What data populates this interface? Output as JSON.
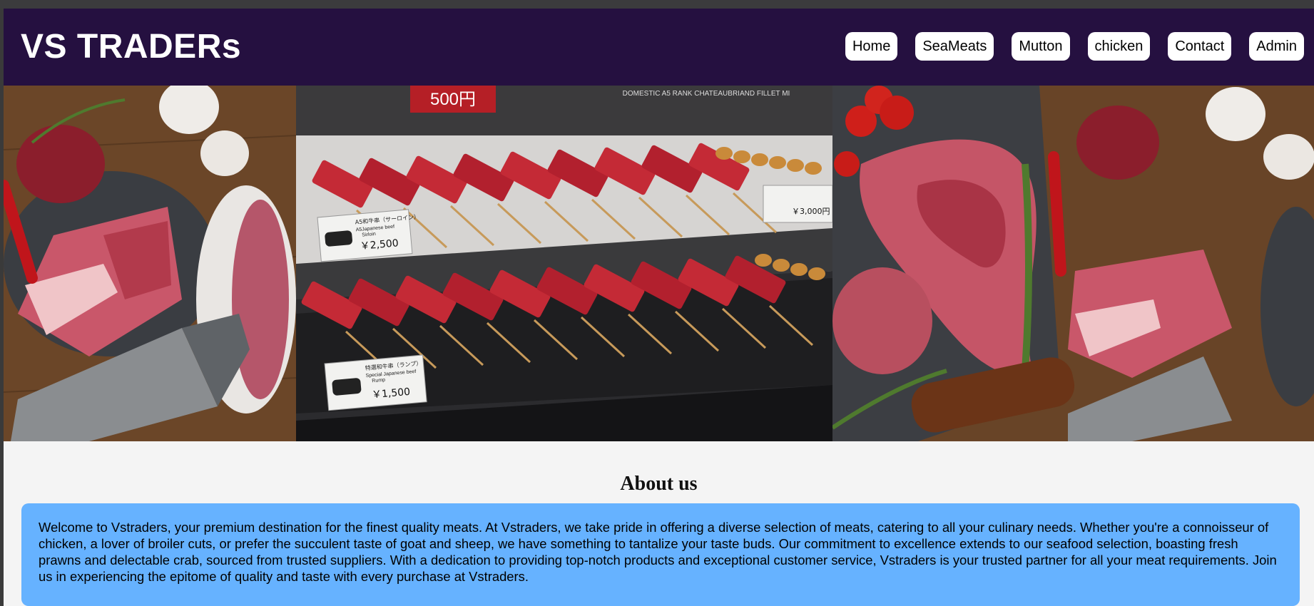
{
  "brand": {
    "title": "VS TRADERs"
  },
  "nav": {
    "items": [
      {
        "label": "Home"
      },
      {
        "label": "SeaMeats"
      },
      {
        "label": "Mutton"
      },
      {
        "label": "chicken"
      },
      {
        "label": "Contact"
      },
      {
        "label": "Admin"
      }
    ]
  },
  "hero": {
    "images": [
      {
        "name": "raw-meat-board-photo"
      },
      {
        "name": "wagyu-skewer-display-photo",
        "labels": {
          "top_price": "500円",
          "sign_domestic": "DOMESTIC A5 RANK CHATEAUBRIAND FILLET MI",
          "tag1_line1": "A5和牛串（サーロイン）",
          "tag1_line2": "A5Japanese beef",
          "tag1_line3": "Sirloin",
          "tag1_price": "￥2,500",
          "tag2_line1": "特選和牛串（ランプ）",
          "tag2_line2": "Special Japanese beef",
          "tag2_line3": "Rump",
          "tag2_price": "￥1,500",
          "tag3_price": "￥3,000円"
        }
      },
      {
        "name": "tbone-steak-board-photo"
      }
    ]
  },
  "about": {
    "title": "About us",
    "text": "Welcome to Vstraders, your premium destination for the finest quality meats. At Vstraders, we take pride in offering a diverse selection of meats, catering to all your culinary needs. Whether you're a connoisseur of chicken, a lover of broiler cuts, or prefer the succulent taste of goat and sheep, we have something to tantalize your taste buds. Our commitment to excellence extends to our seafood selection, boasting fresh prawns and delectable crab, sourced from trusted suppliers. With a dedication to providing top-notch products and exceptional customer service, Vstraders is your trusted partner for all your meat requirements. Join us in experiencing the epitome of quality and taste with every purchase at Vstraders."
  },
  "colors": {
    "navbar_bg": "#251040",
    "about_box_bg": "#66b2ff",
    "page_bg": "#f4f4f4"
  }
}
